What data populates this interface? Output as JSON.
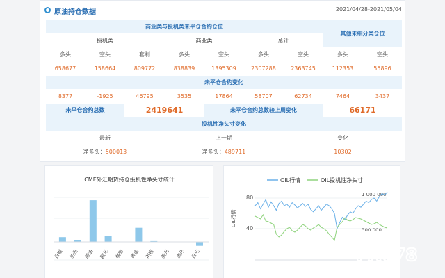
{
  "header": {
    "title": "原油持仓数据",
    "date_range": "2021/04/28-2021/05/04"
  },
  "table": {
    "group_commercial_noncommercial": "商业类与投机类未平仓合约仓位",
    "group_other": "其他未细分类仓位",
    "col_speculative": "投机类",
    "col_commercial": "商业类",
    "col_total": "总计",
    "label_long": "多头",
    "label_short": "空头",
    "label_spread": "套利",
    "positions": {
      "spec_long": "658677",
      "spec_short": "158664",
      "spec_spread": "809772",
      "comm_long": "838839",
      "comm_short": "1395309",
      "total_long": "2307288",
      "total_short": "2363745",
      "other_long": "112353",
      "other_short": "55896"
    },
    "changes_title": "未平仓合约变化",
    "changes": [
      "8377",
      "-1925",
      "46795",
      "3535",
      "17864",
      "58707",
      "62734",
      "7464",
      "3437"
    ],
    "oi_total_label": "未平仓合约总数",
    "oi_total_value": "2419641",
    "oi_change_label": "未平仓合约总数较上周变化",
    "oi_change_value": "66171",
    "net_title": "投机性净头寸变化",
    "net_latest_label": "最新",
    "net_prev_label": "上一期",
    "net_change_label": "变化",
    "net_prefix": "净多头：",
    "net_latest_value": "500013",
    "net_prev_value": "489711",
    "net_change_value": "10302"
  },
  "bar_chart": {
    "title": "CME外汇期货持仓投机性净头寸统计",
    "color": "#8ec8ea",
    "chart_data": {
      "type": "bar",
      "title": "CME外汇期货持仓投机性净头寸统计",
      "categories": [
        "日银",
        "加元",
        "原油",
        "欧元",
        "瑞郎",
        "黄金",
        "英镑",
        "美元",
        "澳元",
        "日元"
      ],
      "values": [
        0.6,
        0.2,
        5.3,
        0.8,
        0,
        1.8,
        0.1,
        0,
        0,
        -0.5
      ],
      "ylim": [
        -1,
        7
      ]
    }
  },
  "line_chart": {
    "legend_oil": "OIL行情",
    "legend_net": "OIL投机性净头寸",
    "ylabel_left": "OIL行情",
    "color_oil": "#6ab0e8",
    "color_net": "#8fd37d",
    "left_ticks": [
      "80",
      "40"
    ],
    "right_ticks": [
      "1 000 000",
      "500 000"
    ],
    "chart_data": {
      "type": "line",
      "ylabel": "OIL行情",
      "y_left_ticks": [
        80,
        40
      ],
      "y_right_ticks": [
        1000000,
        500000
      ],
      "series": [
        {
          "name": "OIL行情",
          "axis": "left",
          "values": [
            70,
            74,
            66,
            72,
            78,
            68,
            75,
            70,
            64,
            73,
            76,
            70,
            72,
            68,
            74,
            71,
            67,
            70,
            73,
            69,
            72,
            65,
            62,
            66,
            70,
            64,
            68,
            72,
            70,
            66,
            60,
            40,
            48,
            55,
            52,
            58,
            62,
            60,
            66,
            70,
            68,
            72,
            76,
            74,
            78,
            80,
            76,
            82,
            86,
            84,
            88
          ]
        },
        {
          "name": "OIL投机性净头寸",
          "axis": "right",
          "values": [
            680000,
            660000,
            640000,
            700000,
            610000,
            600000,
            580000,
            560000,
            420000,
            380000,
            410000,
            460000,
            500000,
            520000,
            470000,
            450000,
            480000,
            520000,
            560000,
            540000,
            500000,
            480000,
            510000,
            530000,
            560000,
            520000,
            500000,
            470000,
            420000,
            380000,
            330000,
            520000,
            560000,
            600000,
            660000,
            620000,
            610000,
            630000,
            660000,
            650000,
            640000,
            620000,
            600000,
            580000,
            560000,
            570000,
            590000,
            560000,
            540000,
            520000,
            510000
          ]
        }
      ]
    }
  },
  "watermark": {
    "text": "FX678"
  }
}
